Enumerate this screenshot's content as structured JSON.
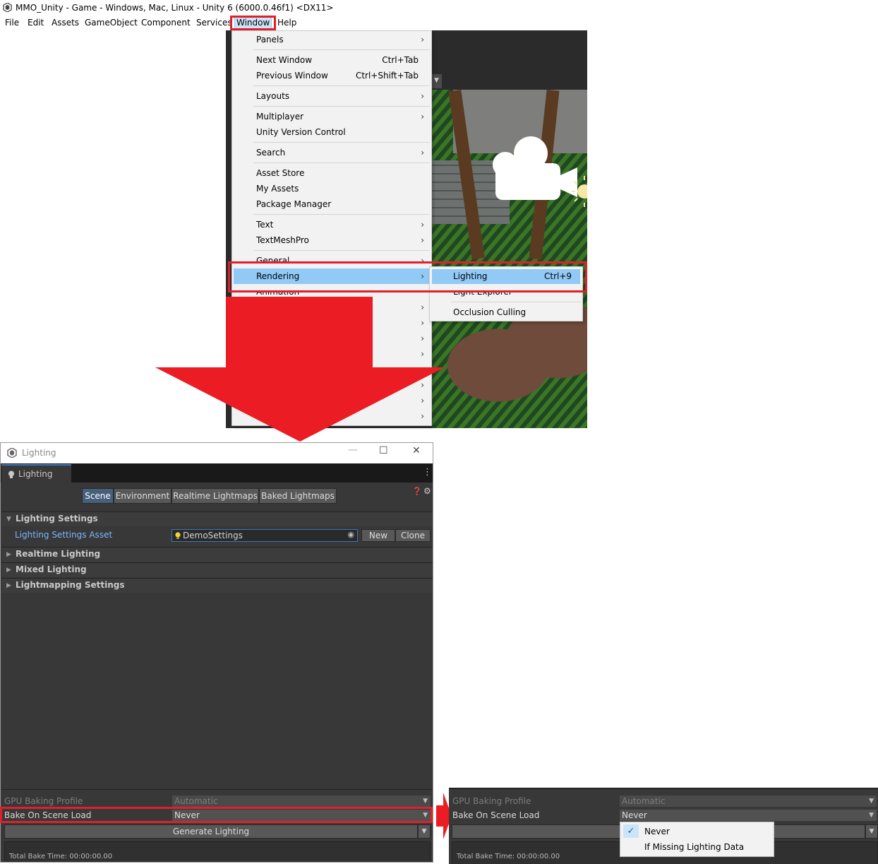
{
  "titlebar": {
    "title": "MMO_Unity - Game - Windows, Mac, Linux - Unity 6 (6000.0.46f1) <DX11>"
  },
  "menubar": {
    "items": [
      "File",
      "Edit",
      "Assets",
      "GameObject",
      "Component",
      "Services",
      "Window",
      "Help"
    ]
  },
  "window_menu": {
    "panels": "Panels",
    "next_window": "Next Window",
    "next_window_sc": "Ctrl+Tab",
    "prev_window": "Previous Window",
    "prev_window_sc": "Ctrl+Shift+Tab",
    "layouts": "Layouts",
    "multiplayer": "Multiplayer",
    "uvc": "Unity Version Control",
    "search": "Search",
    "asset_store": "Asset Store",
    "my_assets": "My Assets",
    "package_manager": "Package Manager",
    "text": "Text",
    "textmeshpro": "TextMeshPro",
    "general": "General",
    "rendering": "Rendering",
    "animation": "Animation"
  },
  "rendering_submenu": {
    "lighting": "Lighting",
    "lighting_sc": "Ctrl+9",
    "light_explorer": "Light Explorer",
    "occlusion": "Occlusion Culling"
  },
  "lighting_window": {
    "title": "Lighting",
    "tab": "Lighting",
    "segments": [
      "Scene",
      "Environment",
      "Realtime Lightmaps",
      "Baked Lightmaps"
    ],
    "sections": {
      "lighting_settings": "Lighting Settings",
      "realtime": "Realtime Lighting",
      "mixed": "Mixed Lighting",
      "lightmapping": "Lightmapping Settings"
    },
    "asset_label": "Lighting Settings Asset",
    "asset_value": "DemoSettings",
    "new_btn": "New",
    "clone_btn": "Clone",
    "gpu_label": "GPU Baking Profile",
    "gpu_value": "Automatic",
    "bake_label": "Bake On Scene Load",
    "bake_value": "Never",
    "generate": "Generate Lighting",
    "total": "Total Bake Time: 00:00:00.00"
  },
  "zoom_panel": {
    "gpu_label": "GPU Baking Profile",
    "gpu_value": "Automatic",
    "bake_label": "Bake On Scene Load",
    "bake_value": "Never",
    "options": [
      "Never",
      "If Missing Lighting Data"
    ],
    "total": "Total Bake Time: 00:00:00.00"
  },
  "colors": {
    "highlight_red": "#e0202a",
    "menu_selection": "#91c9f7",
    "unity_blue": "#3a79bb"
  }
}
